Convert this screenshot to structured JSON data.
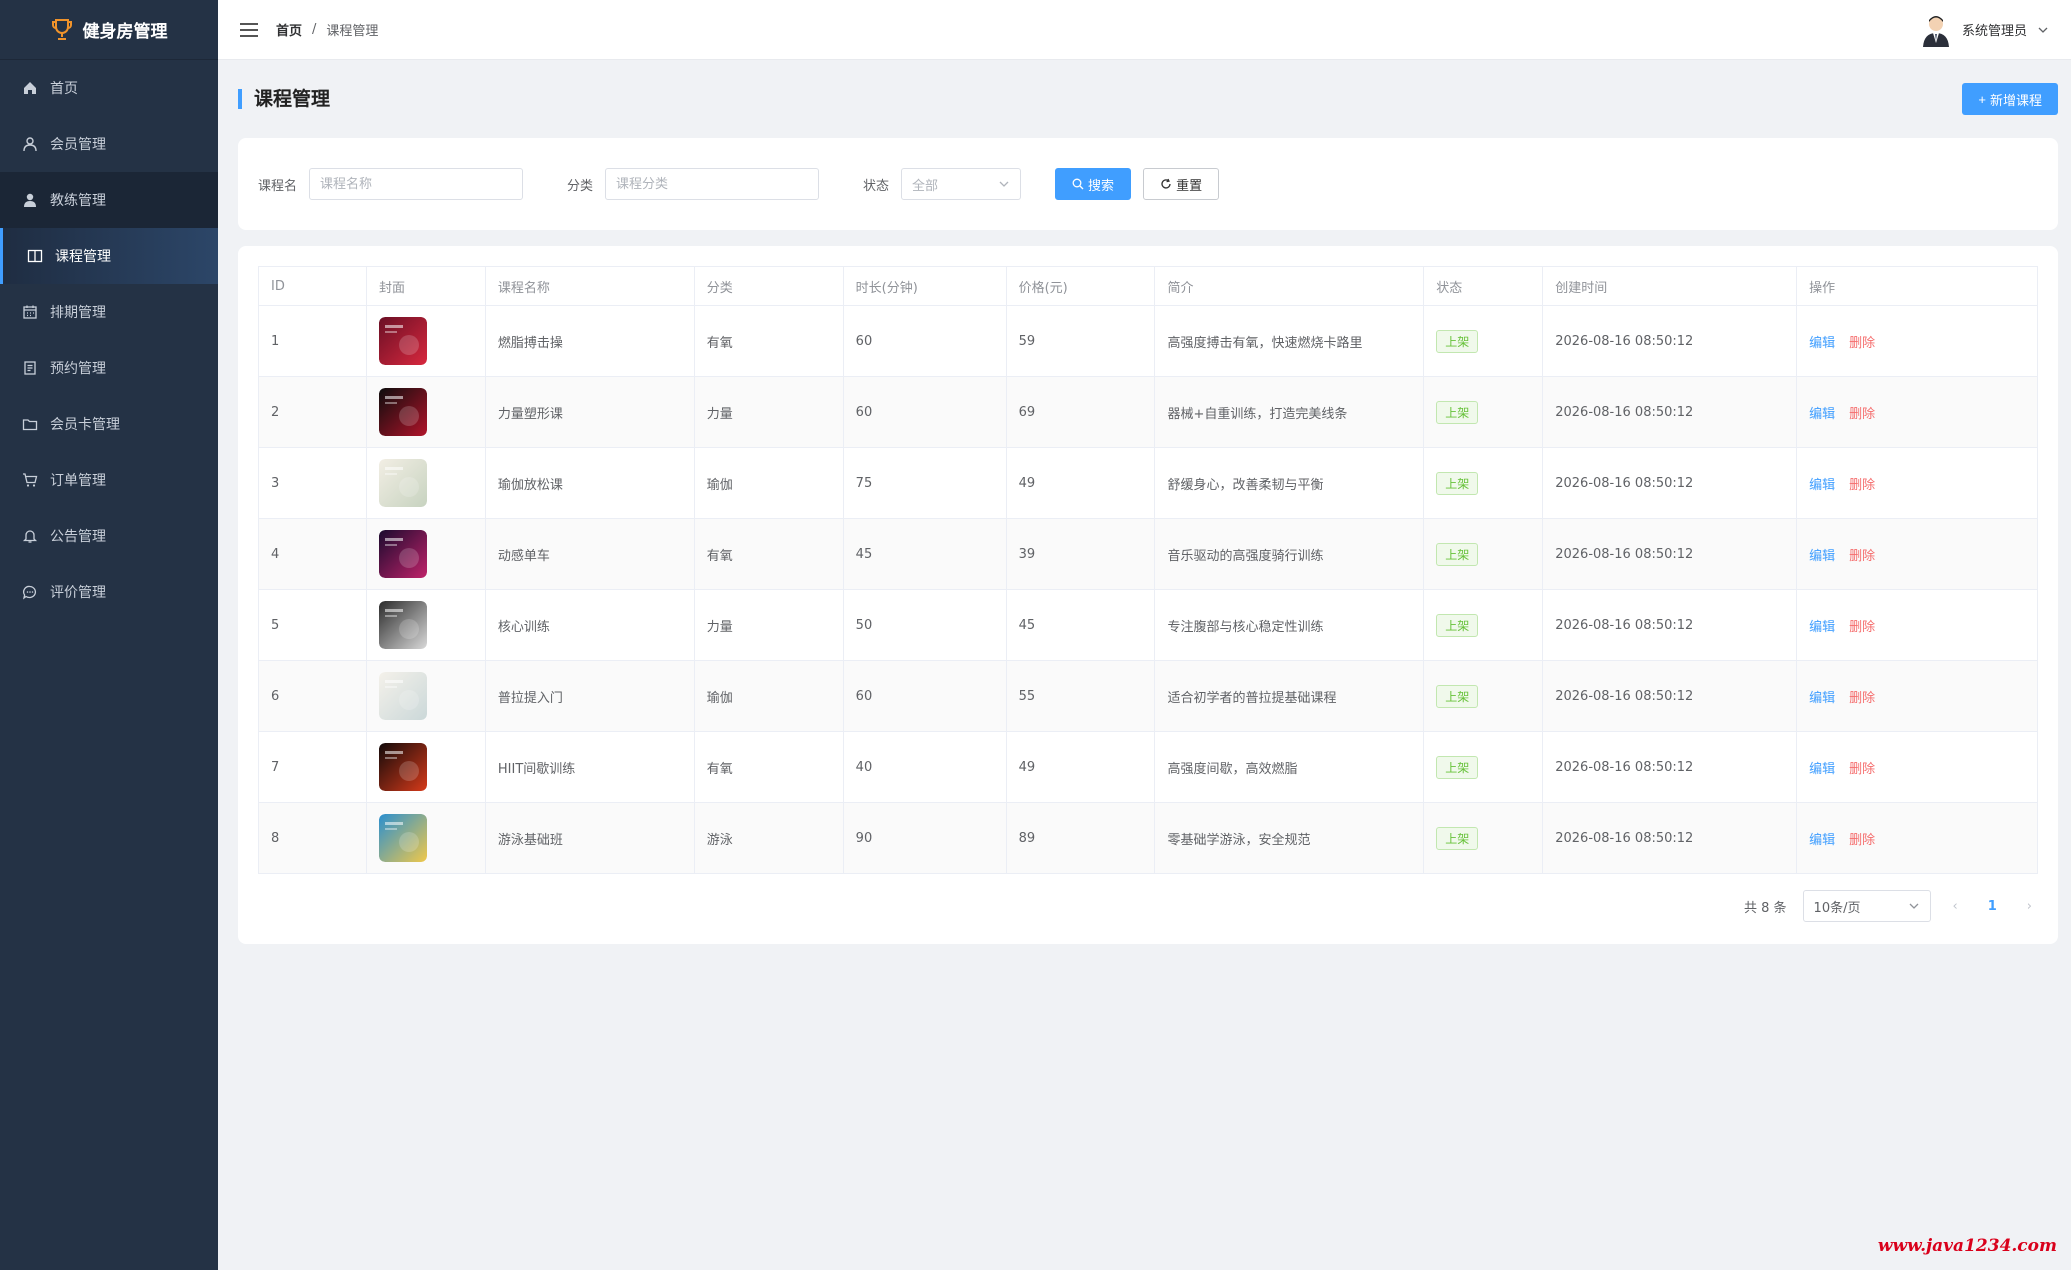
{
  "app": {
    "title": "健身房管理"
  },
  "sidebar": {
    "items": [
      {
        "label": "首页",
        "icon": "home-icon"
      },
      {
        "label": "会员管理",
        "icon": "user-icon"
      },
      {
        "label": "教练管理",
        "icon": "coach-icon"
      },
      {
        "label": "课程管理",
        "icon": "book-icon"
      },
      {
        "label": "排期管理",
        "icon": "calendar-icon"
      },
      {
        "label": "预约管理",
        "icon": "document-icon"
      },
      {
        "label": "会员卡管理",
        "icon": "folder-icon"
      },
      {
        "label": "订单管理",
        "icon": "cart-icon"
      },
      {
        "label": "公告管理",
        "icon": "bell-icon"
      },
      {
        "label": "评价管理",
        "icon": "chat-icon"
      }
    ],
    "active_index": 3
  },
  "header": {
    "breadcrumb_home": "首页",
    "breadcrumb_sep": "/",
    "breadcrumb_current": "课程管理",
    "user_name": "系统管理员"
  },
  "page": {
    "title": "课程管理",
    "add_button": "新增课程"
  },
  "filter": {
    "name_label": "课程名",
    "name_placeholder": "课程名称",
    "category_label": "分类",
    "category_placeholder": "课程分类",
    "status_label": "状态",
    "status_value": "全部",
    "search_button": "搜索",
    "reset_button": "重置"
  },
  "table": {
    "headers": [
      "ID",
      "封面",
      "课程名称",
      "分类",
      "时长(分钟)",
      "价格(元)",
      "简介",
      "状态",
      "创建时间",
      "操作"
    ],
    "rows": [
      {
        "id": "1",
        "name": "燃脂搏击操",
        "category": "有氧",
        "duration": "60",
        "price": "59",
        "desc": "高强度搏击有氧，快速燃烧卡路里",
        "status": "上架",
        "created": "2026-08-16 08:50:12",
        "edit": "编辑",
        "delete": "删除"
      },
      {
        "id": "2",
        "name": "力量塑形课",
        "category": "力量",
        "duration": "60",
        "price": "69",
        "desc": "器械+自重训练，打造完美线条",
        "status": "上架",
        "created": "2026-08-16 08:50:12",
        "edit": "编辑",
        "delete": "删除"
      },
      {
        "id": "3",
        "name": "瑜伽放松课",
        "category": "瑜伽",
        "duration": "75",
        "price": "49",
        "desc": "舒缓身心，改善柔韧与平衡",
        "status": "上架",
        "created": "2026-08-16 08:50:12",
        "edit": "编辑",
        "delete": "删除"
      },
      {
        "id": "4",
        "name": "动感单车",
        "category": "有氧",
        "duration": "45",
        "price": "39",
        "desc": "音乐驱动的高强度骑行训练",
        "status": "上架",
        "created": "2026-08-16 08:50:12",
        "edit": "编辑",
        "delete": "删除"
      },
      {
        "id": "5",
        "name": "核心训练",
        "category": "力量",
        "duration": "50",
        "price": "45",
        "desc": "专注腹部与核心稳定性训练",
        "status": "上架",
        "created": "2026-08-16 08:50:12",
        "edit": "编辑",
        "delete": "删除"
      },
      {
        "id": "6",
        "name": "普拉提入门",
        "category": "瑜伽",
        "duration": "60",
        "price": "55",
        "desc": "适合初学者的普拉提基础课程",
        "status": "上架",
        "created": "2026-08-16 08:50:12",
        "edit": "编辑",
        "delete": "删除"
      },
      {
        "id": "7",
        "name": "HIIT间歇训练",
        "category": "有氧",
        "duration": "40",
        "price": "49",
        "desc": "高强度间歇，高效燃脂",
        "status": "上架",
        "created": "2026-08-16 08:50:12",
        "edit": "编辑",
        "delete": "删除"
      },
      {
        "id": "8",
        "name": "游泳基础班",
        "category": "游泳",
        "duration": "90",
        "price": "89",
        "desc": "零基础学游泳，安全规范",
        "status": "上架",
        "created": "2026-08-16 08:50:12",
        "edit": "编辑",
        "delete": "删除"
      }
    ]
  },
  "pagination": {
    "total_text": "共 8 条",
    "page_size": "10条/页",
    "current_page": "1"
  },
  "watermark": "www.java1234.com",
  "colors": {
    "sidebar_bg": "#243245",
    "accent": "#409eff",
    "success": "#67c23a",
    "danger": "#f56c6c",
    "watermark": "#d9001b"
  }
}
